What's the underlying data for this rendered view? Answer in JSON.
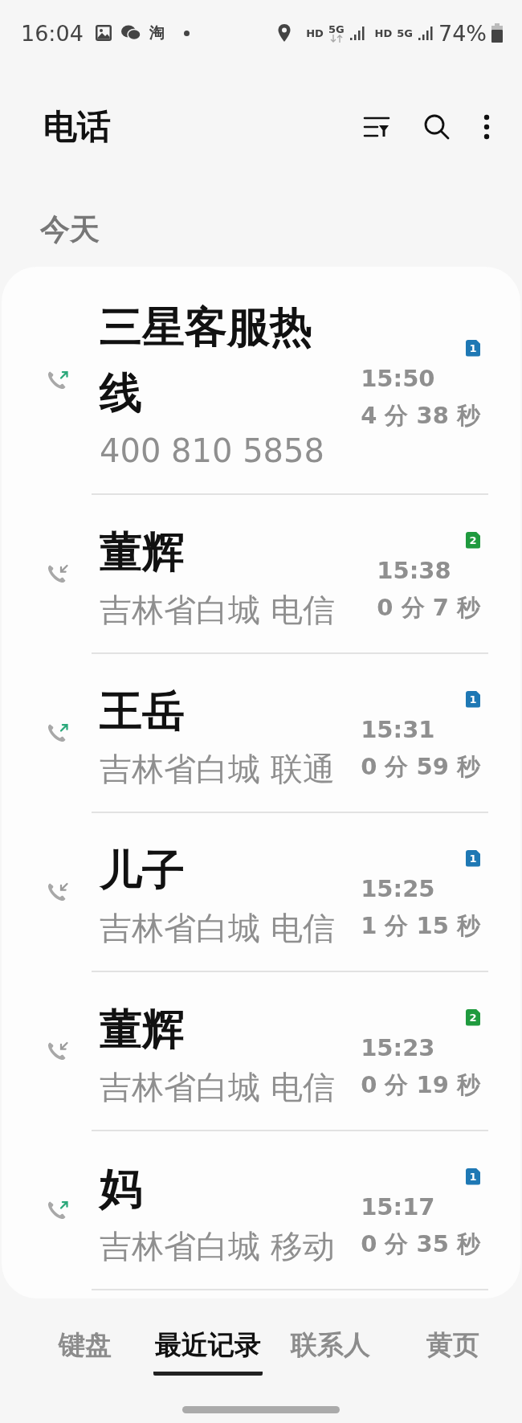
{
  "status_bar": {
    "time": "16:04",
    "app_glyph": "淘",
    "sims": [
      {
        "hd": "HD",
        "network": "5G",
        "data_arrows": true
      },
      {
        "hd": "HD",
        "network": "5G",
        "data_arrows": false
      }
    ],
    "battery": "74%"
  },
  "header": {
    "title": "电话"
  },
  "section": "今天",
  "calls": [
    {
      "name": "三星客服热线",
      "detail": "400 810 5858",
      "time": "15:50",
      "duration": "4 分 38 秒",
      "kind": "outgoing",
      "sim": "1",
      "color": "#1e78b4"
    },
    {
      "name": "董辉",
      "detail": "吉林省白城 电信",
      "time": "15:38",
      "duration": "0 分 7 秒",
      "kind": "incoming",
      "sim": "2",
      "color": "#1f9a3e"
    },
    {
      "name": "王岳",
      "detail": "吉林省白城 联通",
      "time": "15:31",
      "duration": "0 分 59 秒",
      "kind": "outgoing",
      "sim": "1",
      "color": "#1e78b4"
    },
    {
      "name": "儿子",
      "detail": "吉林省白城 电信",
      "time": "15:25",
      "duration": "1 分 15 秒",
      "kind": "incoming",
      "sim": "1",
      "color": "#1e78b4"
    },
    {
      "name": "董辉",
      "detail": "吉林省白城 电信",
      "time": "15:23",
      "duration": "0 分 19 秒",
      "kind": "incoming",
      "sim": "2",
      "color": "#1f9a3e"
    },
    {
      "name": "妈",
      "detail": "吉林省白城 移动",
      "time": "15:17",
      "duration": "0 分 35 秒",
      "kind": "outgoing",
      "sim": "1",
      "color": "#1e78b4"
    }
  ],
  "tabs": [
    {
      "label": "键盘",
      "selected": false
    },
    {
      "label": "最近记录",
      "selected": true
    },
    {
      "label": "联系人",
      "selected": false
    },
    {
      "label": "黄页",
      "selected": false
    }
  ]
}
